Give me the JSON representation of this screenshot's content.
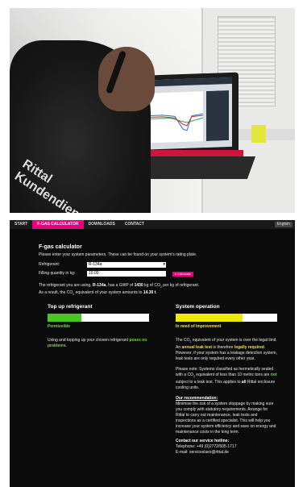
{
  "photo": {
    "shirt_text": "Rittal\nKundendienst"
  },
  "nav": {
    "items": [
      "START",
      "F-GAS CALCULATOR",
      "DOWNLOADS",
      "CONTACT"
    ],
    "language": "English"
  },
  "calculator": {
    "title": "F-gas calculator",
    "intro": "Please enter your system parameters. These can be found on your system's rating plate.",
    "refrigerant_label": "Refrigerant:",
    "refrigerant_value": "R-134a",
    "filling_label": "Filling quantity in kg:",
    "filling_value": "10.00",
    "calculate_button": "Calculate",
    "result_line1_a": "The refrigerant you are using, ",
    "result_line1_ref": "R-134a",
    "result_line1_b": ", has a GWP of ",
    "result_gwp": "1430",
    "result_line1_c": " kg of CO",
    "result_line1_d": " per kg of refrigerant.",
    "result_line2_a": "As a result, the CO",
    "result_line2_b": " equivalent of your system amounts to ",
    "result_co2": "14.30 t",
    "result_line2_end": "."
  },
  "left": {
    "heading": "Top up refrigerant",
    "status": "Permissible",
    "meter_fraction": 0.33,
    "meter_color": "#46c81e",
    "text_a": "Using and topping up your chosen refrigerant ",
    "text_highlight": "poses no problems."
  },
  "right": {
    "heading": "System operation",
    "status": "In need of improvement",
    "meter_fraction": 0.66,
    "meter_color": "#f0e80a",
    "p1_a": "The CO",
    "p1_b": " equivalent of your system is over the legal limit. An ",
    "p1_bold": "annual leak test",
    "p1_c": " is therefore ",
    "p1_bold2": "legally required",
    "p1_d": ".",
    "p1_e": "However, if your system has a leakage detection system, leak tests are only required every other year.",
    "p2_a": "Please note: Systems classified as hermetically sealed with a CO",
    "p2_b": " equivalent of less than 10 metric tons are ",
    "p2_not": "not",
    "p2_c": " subject to a leak test. This applies to ",
    "p2_all": "all",
    "p2_d": " Rittal enclosure cooling units.",
    "reco_title": "Our recommendation:",
    "reco_text": "Minimise the risk of a system stoppage by making sure you comply with statutory requirements. Arrange for Rittal to carry out maintenance, leak tests and inspections as a certified specialist. This will help you increase your system efficiency and save on energy and maintenance costs in the long term.",
    "contact_title": "Contact our service hotline:",
    "phone": "Telephone: +49 (0)2772/505-1717",
    "email": "E-mail: serviceslaes@rittal.de"
  },
  "colors": {
    "accent": "#e6007e",
    "background": "#0b0b0b"
  }
}
